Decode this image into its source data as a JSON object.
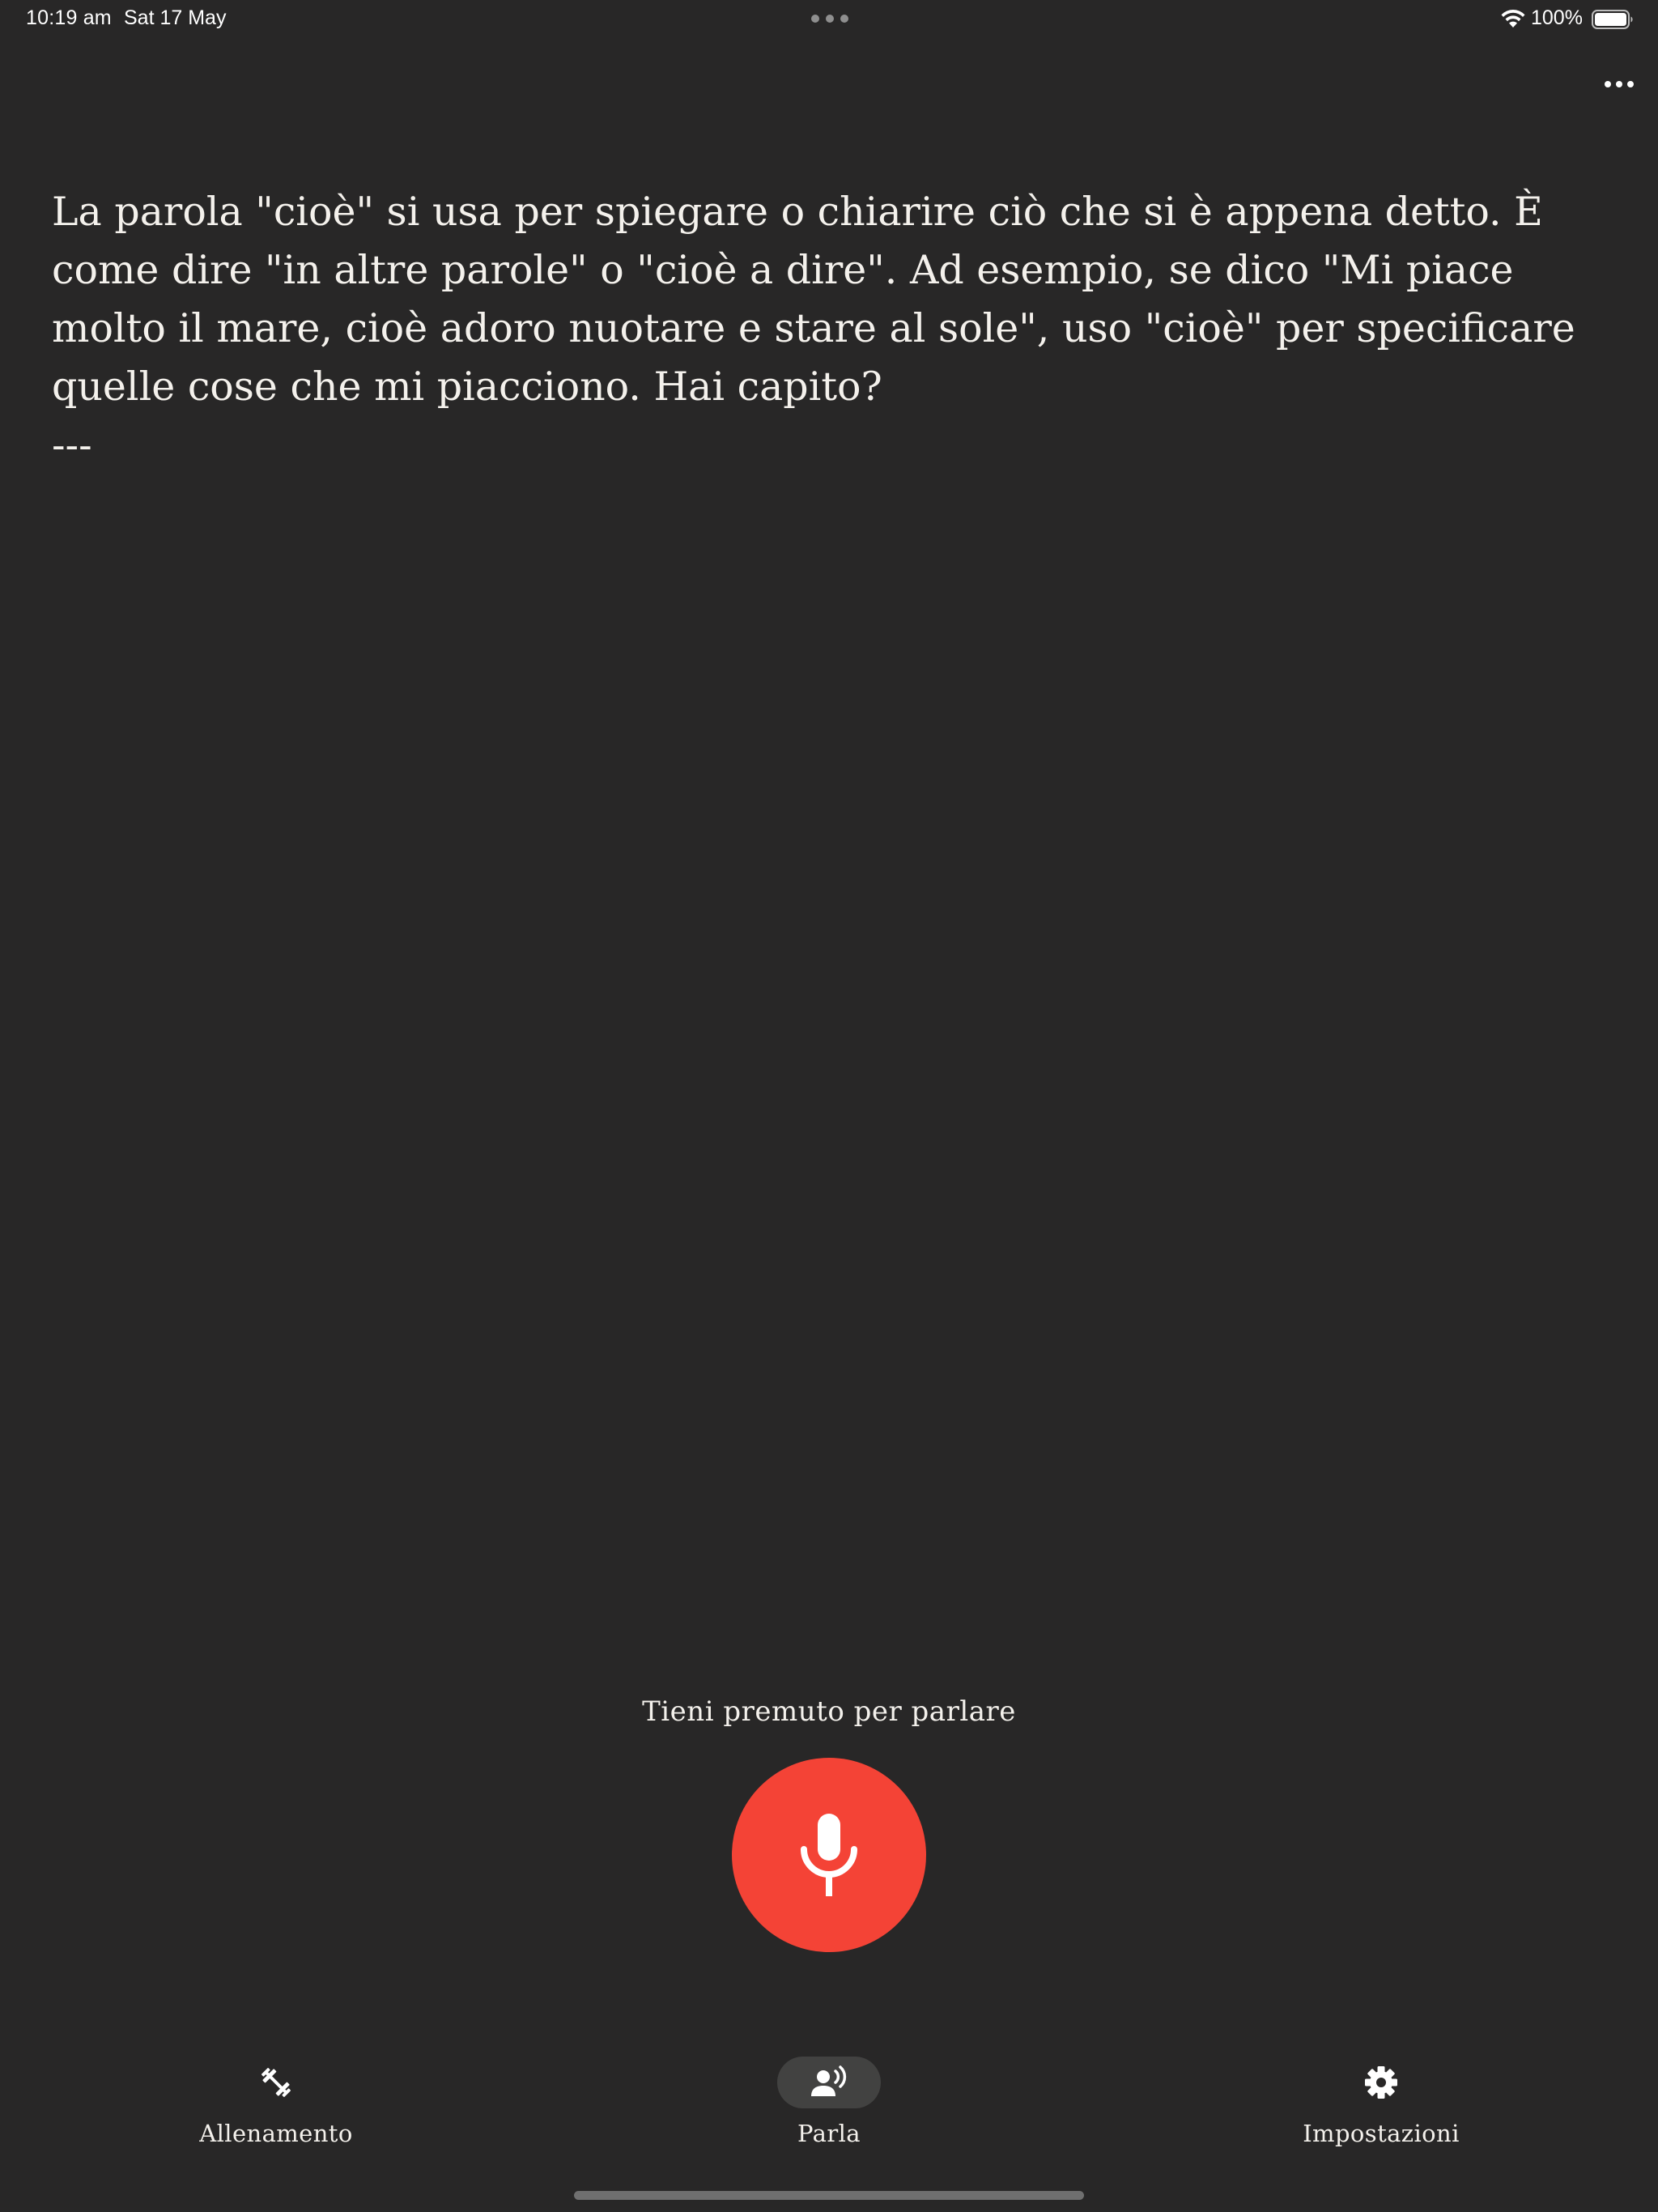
{
  "status_bar": {
    "time": "10:19 am",
    "date": "Sat 17 May",
    "battery_percent": "100%",
    "battery_level": 1.0,
    "icons": [
      "wifi-icon",
      "battery-icon"
    ]
  },
  "top_bar": {
    "more_icon": "ellipsis-icon"
  },
  "message": {
    "text": "La parola \"cioè\" si usa per spiegare o chiarire ciò che si è appena detto. È come dire \"in altre parole\" o \"cioè a dire\". Ad esempio, se dico \"Mi piace molto il mare, cioè adoro nuotare e stare al sole\", uso \"cioè\" per specificare quelle cose che mi piacciono. Hai capito?\n---"
  },
  "push_to_talk": {
    "hint": "Tieni premuto per parlare",
    "icon": "microphone-icon",
    "color": "#f44336"
  },
  "bottom_nav": {
    "items": [
      {
        "label": "Allenamento",
        "icon": "dumbbell-icon",
        "active": false
      },
      {
        "label": "Parla",
        "icon": "speaking-person-icon",
        "active": true
      },
      {
        "label": "Impostazioni",
        "icon": "gear-icon",
        "active": false
      }
    ]
  },
  "colors": {
    "background": "#282727",
    "text": "#f4f1ec",
    "accent_red": "#f44336",
    "active_pill": "#424241"
  }
}
